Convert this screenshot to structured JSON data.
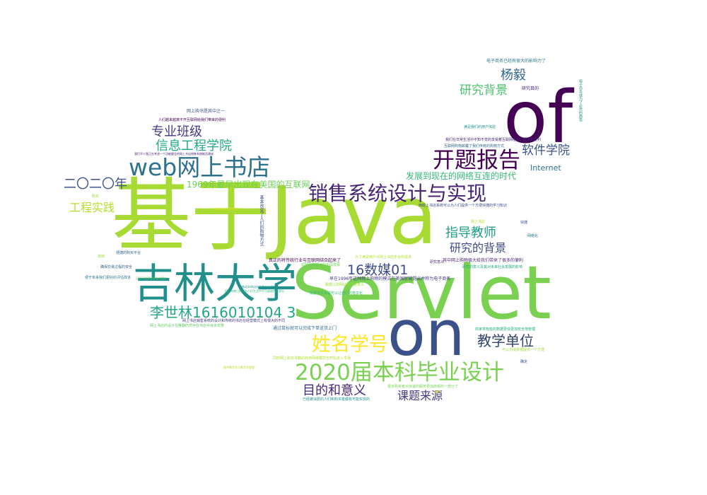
{
  "wordcloud": {
    "words": [
      {
        "text": "基于Java",
        "color": "#a7db34"
      },
      {
        "text": "Servlet",
        "color": "#7ad151"
      },
      {
        "text": "on",
        "color": "#3b518a"
      },
      {
        "text": "of",
        "color": "#440154"
      },
      {
        "text": "吉林大学",
        "color": "#21908d"
      },
      {
        "text": "web网上书店",
        "color": "#2c728e"
      },
      {
        "text": "开题报告",
        "color": "#440154"
      },
      {
        "text": "销售系统设计与实现",
        "color": "#482475"
      },
      {
        "text": "2020届本科毕业设计",
        "color": "#7ad151"
      },
      {
        "text": "姓名学号",
        "color": "#fde725"
      },
      {
        "text": "李世林1616010104 3",
        "color": "#21a685"
      },
      {
        "text": "16数媒01",
        "color": "#3e4c8a"
      },
      {
        "text": "教学单位",
        "color": "#31446b"
      },
      {
        "text": "目的和意义",
        "color": "#482878"
      },
      {
        "text": "课题来源",
        "color": "#443a83"
      },
      {
        "text": "二〇二〇年",
        "color": "#3b528b"
      },
      {
        "text": "专业班级",
        "color": "#443983"
      },
      {
        "text": "信息工程学院",
        "color": "#22a884"
      },
      {
        "text": "工程实践",
        "color": "#b5de2b"
      },
      {
        "text": "杨毅",
        "color": "#31688e"
      },
      {
        "text": "研究背景",
        "color": "#4ac16d"
      },
      {
        "text": "软件学院",
        "color": "#3b528b"
      },
      {
        "text": "指导教师",
        "color": "#1f9e89"
      },
      {
        "text": "研究的背景",
        "color": "#3e4a89"
      },
      {
        "text": "发展到现在的网络互连的时代",
        "color": "#35b779"
      },
      {
        "text": "1969年最早出现在美国的互联网",
        "color": "#6ece58"
      },
      {
        "text": "Internet",
        "color": "#2c728e"
      },
      {
        "text": "电子商务已经有很大的影响力了",
        "color": "#2a788e"
      },
      {
        "text": "研究目的",
        "color": "#482173"
      },
      {
        "text": "网上购书是其中之一",
        "color": "#3b528b"
      },
      {
        "text": "人们越来越离不开互联网给我们带来的便利",
        "color": "#440154"
      },
      {
        "text": "我们在日常生活中不知不觉的享受着互联网给我们带来的便利",
        "color": "#482475"
      },
      {
        "text": "互联网购物颠覆了我们传统的购物方式",
        "color": "#31688e"
      },
      {
        "text": "满足我们的用户体验",
        "color": "#21918c"
      },
      {
        "text": "西班上书店系统可以为人们提供一个方便快捷的学习知识",
        "color": "#3e4a89"
      },
      {
        "text": "真正的将传统行业与互联网结合起来了",
        "color": "#440154"
      },
      {
        "text": "早在1996年这种网上购物的模式在美国就被提出并称为电子商务",
        "color": "#443983"
      },
      {
        "text": "其中网上购物极大给我们带来了很多的便利",
        "color": "#482878"
      },
      {
        "text": "通过鼠标就可以完成下单送货上门",
        "color": "#31688e"
      },
      {
        "text": "网上书店销售系统的设计和传统的书店在经营模式上有很大的不同",
        "color": "#453781"
      },
      {
        "text": "网上书店的设计在推翻仍然存在书店中许多优势",
        "color": "#5ec962"
      },
      {
        "text": "现代信息技术的手段发展",
        "color": "#6ece58"
      },
      {
        "text": "基本改变了人们的购物方式",
        "color": "#3e4c8a"
      },
      {
        "text": "便捷的购买平台",
        "color": "#31688e"
      },
      {
        "text": "网络化",
        "color": "#2c728e"
      },
      {
        "text": "快捷",
        "color": "#3b528b"
      },
      {
        "text": "高效",
        "color": "#a0da39"
      },
      {
        "text": "确保交易过程的安全",
        "color": "#365c8d"
      },
      {
        "text": "便于未来我们更好的评估改进",
        "color": "#2a788e"
      },
      {
        "text": "跟据以前网站的改进意义",
        "color": "#9fda3a"
      },
      {
        "text": "需要很多来说可以让他们的电子化",
        "color": "#35b779"
      },
      {
        "text": "商家将有些的数据更快更加安全地管理",
        "color": "#22a884"
      },
      {
        "text": "同时网上购买书籍的商用网络模式也开始进入市场",
        "color": "#b5de2b"
      },
      {
        "text": "电商发展的初期形态",
        "color": "#d8e219"
      },
      {
        "text": "很多购买者对快速的服务更加高频的一部分了",
        "color": "#7ad151"
      },
      {
        "text": "已经被消费的人们和购买者都有可能实现的",
        "color": "#21918c"
      },
      {
        "text": "确定",
        "color": "#3b528b"
      },
      {
        "text": "可以为消费者提供一个方便",
        "color": "#a0da39"
      },
      {
        "text": "研究意义",
        "color": "#482878"
      },
      {
        "text": "为了满足用户对网上书店平台的需求",
        "color": "#b5de2b"
      },
      {
        "text": "研究的意义及其对未来社会发展的影响",
        "color": "#22a884"
      },
      {
        "text": "推动实体店向网络方向的转型",
        "color": "#21918c"
      },
      {
        "text": "已经不能满足现有的需求",
        "color": "#5ec962"
      },
      {
        "text": "我们不少我正在考虑一个功能健全的网上书店销售系统能否建成",
        "color": "#482173"
      },
      {
        "text": "网上购物已经成为人们生活中不可或缺的一部分",
        "color": "#35b779"
      },
      {
        "text": "图书数字化与数字化管理",
        "color": "#b5de2b"
      },
      {
        "text": "电子商务成为了必然的趋势",
        "color": "#21918c"
      },
      {
        "text": "网上书店",
        "color": "#b5de2b"
      },
      {
        "text": "购买",
        "color": "#9fda3a"
      },
      {
        "text": "用户",
        "color": "#d8e219"
      }
    ]
  }
}
